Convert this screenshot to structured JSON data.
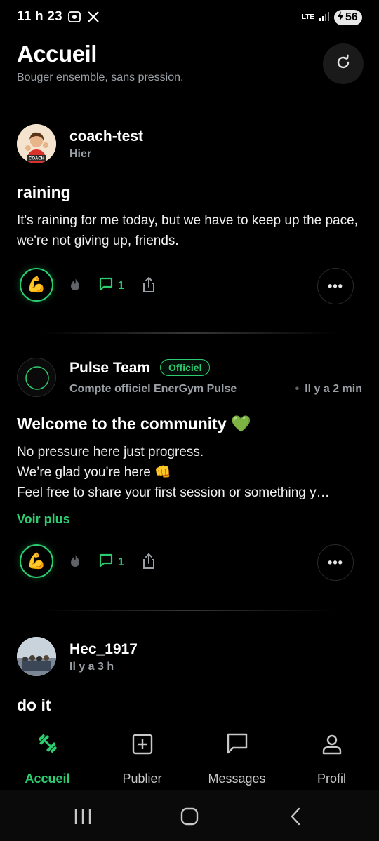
{
  "status": {
    "time": "11 h 23",
    "network": "LTE",
    "battery": "56"
  },
  "header": {
    "title": "Accueil",
    "subtitle": "Bouger ensemble, sans pression."
  },
  "posts": [
    {
      "author": "coach-test",
      "time": "Hier",
      "avatar_label": "COACH",
      "title": "raining",
      "body": "It's raining for me today, but we have to keep up the pace, we're not giving up, friends.",
      "reaction": "💪",
      "comments": "1"
    },
    {
      "author": "Pulse Team",
      "badge": "Officiel",
      "subtitle": "Compte officiel EnerGym Pulse",
      "time": "Il y a 2 min",
      "title": "Welcome to the community 💚",
      "body_lines": [
        "No pressure here just progress.",
        "We’re glad you’re here 👊",
        "Feel free to share your first session or something y…"
      ],
      "see_more": "Voir plus",
      "reaction": "💪",
      "comments": "1"
    },
    {
      "author": "Hec_1917",
      "time": "Il y a 3 h",
      "title": "do it"
    }
  ],
  "nav": {
    "items": [
      {
        "label": "Accueil",
        "icon": "dumbbell-icon",
        "active": true
      },
      {
        "label": "Publier",
        "icon": "plus-square-icon",
        "active": false
      },
      {
        "label": "Messages",
        "icon": "message-icon",
        "active": false
      },
      {
        "label": "Profil",
        "icon": "user-icon",
        "active": false
      }
    ]
  },
  "colors": {
    "accent": "#2ecc71",
    "background": "#000000",
    "muted": "#9aa0a6"
  }
}
